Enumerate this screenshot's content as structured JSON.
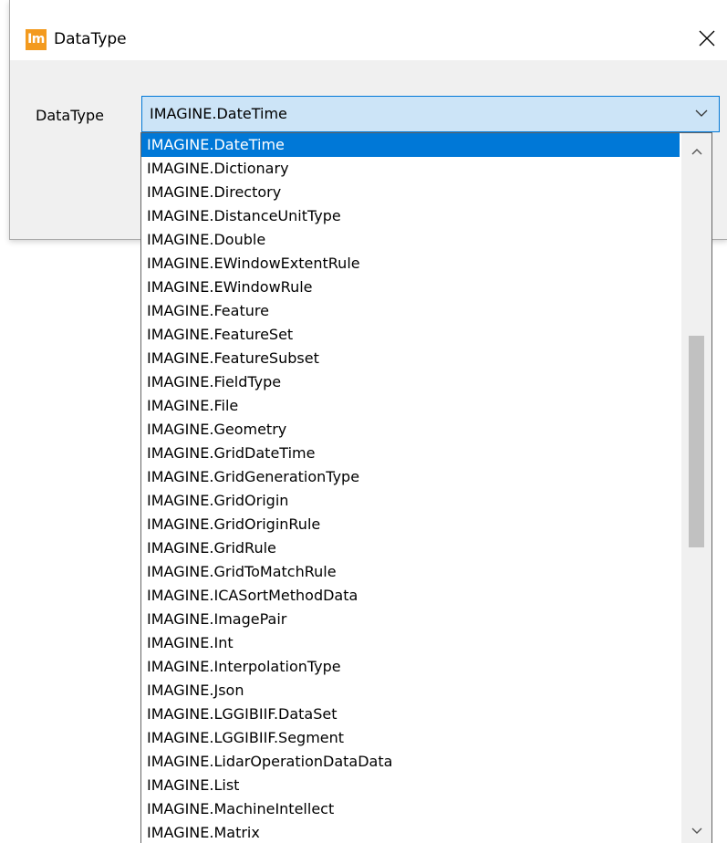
{
  "window": {
    "icon_text": "Im",
    "title": "DataType"
  },
  "form": {
    "label": "DataType",
    "selected_value": "IMAGINE.DateTime"
  },
  "dropdown": {
    "items": [
      "IMAGINE.DateTime",
      "IMAGINE.Dictionary",
      "IMAGINE.Directory",
      "IMAGINE.DistanceUnitType",
      "IMAGINE.Double",
      "IMAGINE.EWindowExtentRule",
      "IMAGINE.EWindowRule",
      "IMAGINE.Feature",
      "IMAGINE.FeatureSet",
      "IMAGINE.FeatureSubset",
      "IMAGINE.FieldType",
      "IMAGINE.File",
      "IMAGINE.Geometry",
      "IMAGINE.GridDateTime",
      "IMAGINE.GridGenerationType",
      "IMAGINE.GridOrigin",
      "IMAGINE.GridOriginRule",
      "IMAGINE.GridRule",
      "IMAGINE.GridToMatchRule",
      "IMAGINE.ICASortMethodData",
      "IMAGINE.ImagePair",
      "IMAGINE.Int",
      "IMAGINE.InterpolationType",
      "IMAGINE.Json",
      "IMAGINE.LGGIBIIF.DataSet",
      "IMAGINE.LGGIBIIF.Segment",
      "IMAGINE.LidarOperationDataData",
      "IMAGINE.List",
      "IMAGINE.MachineIntellect",
      "IMAGINE.Matrix"
    ],
    "selected_index": 0
  },
  "icons": {
    "close": "close-icon",
    "combo_arrow": "chevron-down-icon",
    "scroll_up": "chevron-up-icon",
    "scroll_down": "chevron-down-icon"
  },
  "colors": {
    "accent": "#0078d7",
    "combo_background": "#cce4f7",
    "app_icon": "#f39a1e",
    "dialog_background": "#f0f0f0"
  }
}
